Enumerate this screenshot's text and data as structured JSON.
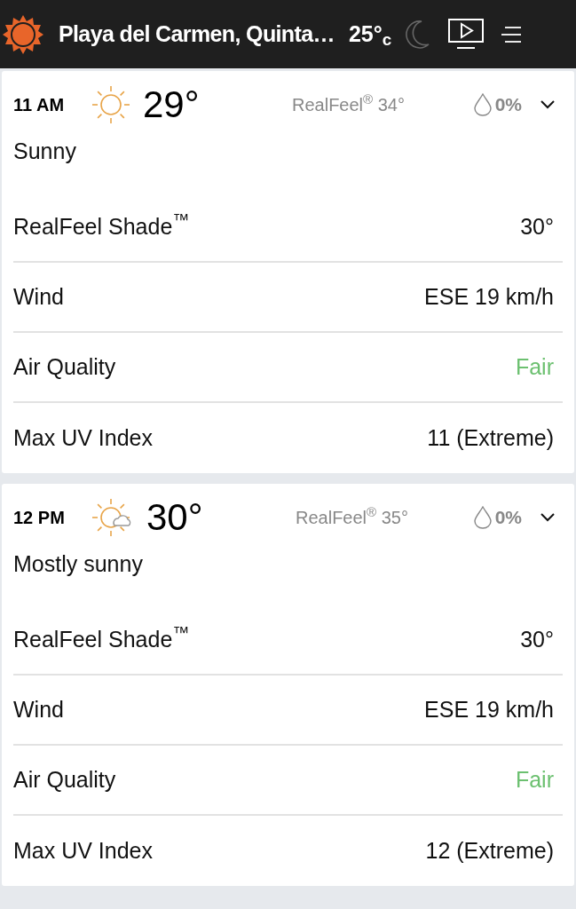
{
  "header": {
    "location": "Playa del Carmen, Quinta…",
    "temperature": "25°$_{c}$"
  },
  "hours": [
    {
      "time": "11 AM",
      "kind": "sunny",
      "temperature": "29°",
      "realfeel": "RealFeel$^{®}$ 34°",
      "precipitation": "0%",
      "condition": "Sunny",
      "details": [
        {
          "label": "RealFeel Shade$^{™}$",
          "value": "30°",
          "color": "#111111"
        },
        {
          "label": "Wind",
          "value": "ESE 19 km/h",
          "color": "#111111"
        },
        {
          "label": "Air Quality",
          "value": "Fair",
          "color": "#6cc070"
        },
        {
          "label": "Max UV Index",
          "value": "11 (Extreme)",
          "color": "#111111"
        }
      ]
    },
    {
      "time": "12 PM",
      "kind": "mostly-sunny",
      "temperature": "30°",
      "realfeel": "RealFeel$^{®}$ 35°",
      "precipitation": "0%",
      "condition": "Mostly sunny",
      "details": [
        {
          "label": "RealFeel Shade$^{™}$",
          "value": "30°",
          "color": "#111111"
        },
        {
          "label": "Wind",
          "value": "ESE 19 km/h",
          "color": "#111111"
        },
        {
          "label": "Air Quality",
          "value": "Fair",
          "color": "#6cc070"
        },
        {
          "label": "Max UV Index",
          "value": "12 (Extreme)",
          "color": "#111111"
        }
      ]
    }
  ]
}
